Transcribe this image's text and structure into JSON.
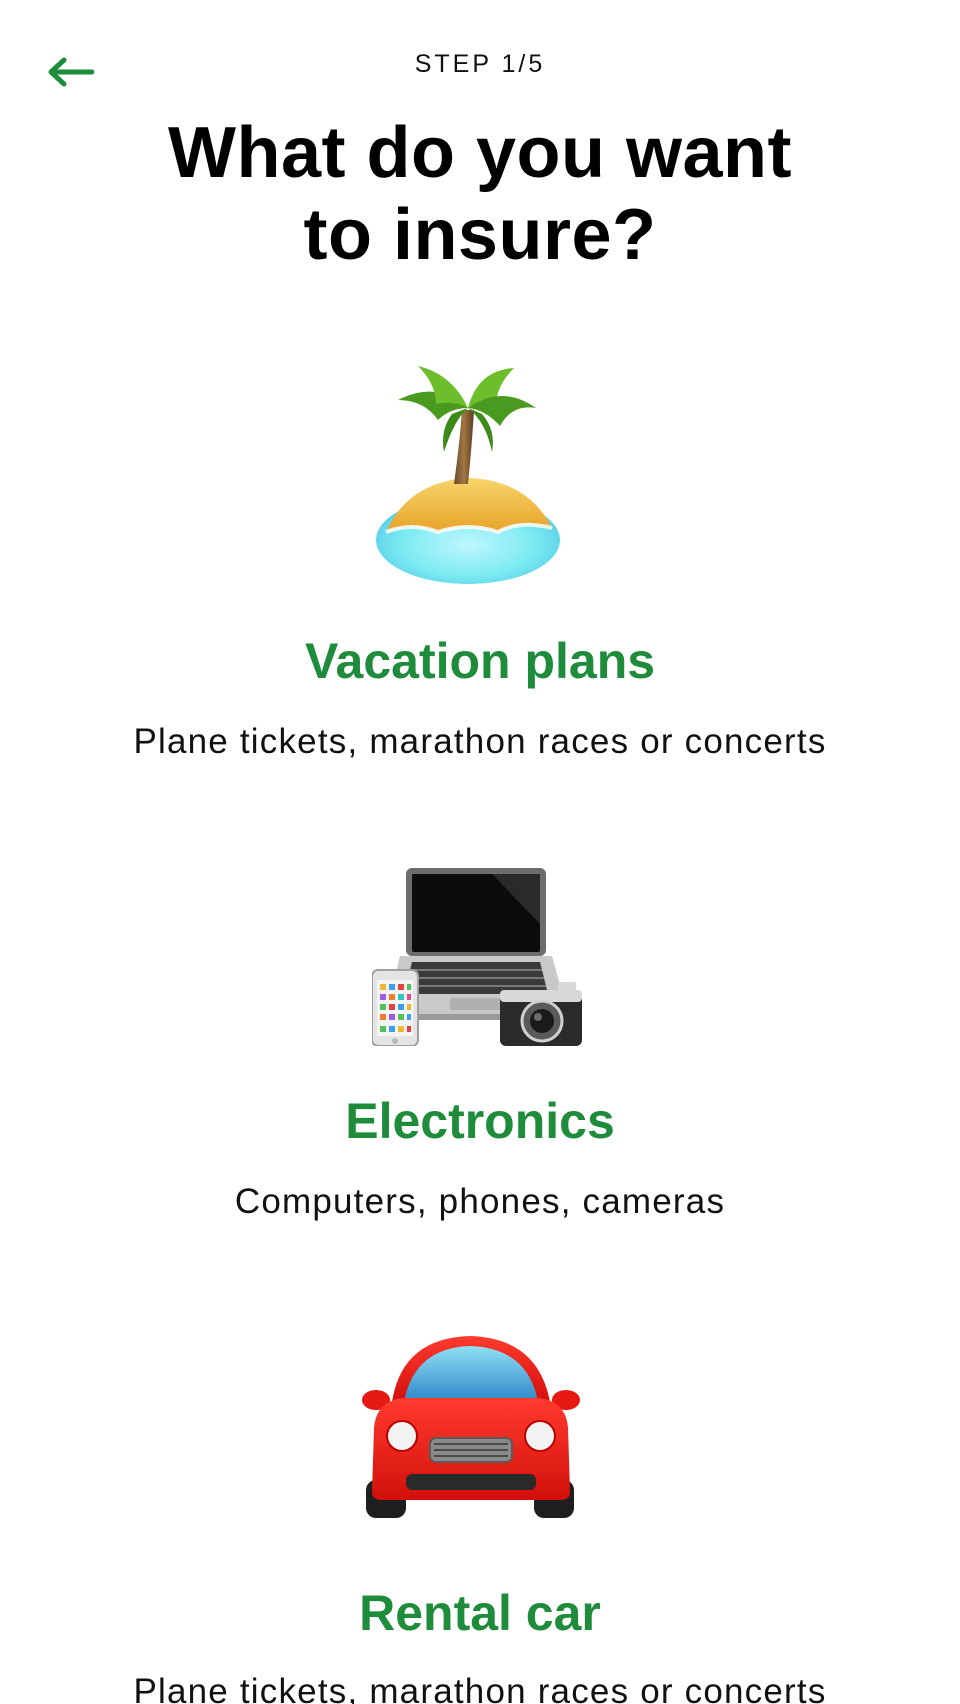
{
  "header": {
    "step_label": "STEP 1/5",
    "title_line1": "What do you want",
    "title_line2": "to insure?"
  },
  "colors": {
    "accent": "#1e8c3a",
    "text": "#111111",
    "background": "#ffffff"
  },
  "options": [
    {
      "icon": "desert-island-icon",
      "title": "Vacation plans",
      "description": "Plane tickets, marathon races or concerts"
    },
    {
      "icon": "electronics-icon",
      "title": "Electronics",
      "description": "Computers, phones, cameras"
    },
    {
      "icon": "car-icon",
      "title": "Rental car",
      "description": "Plane tickets, marathon races or concerts"
    }
  ]
}
